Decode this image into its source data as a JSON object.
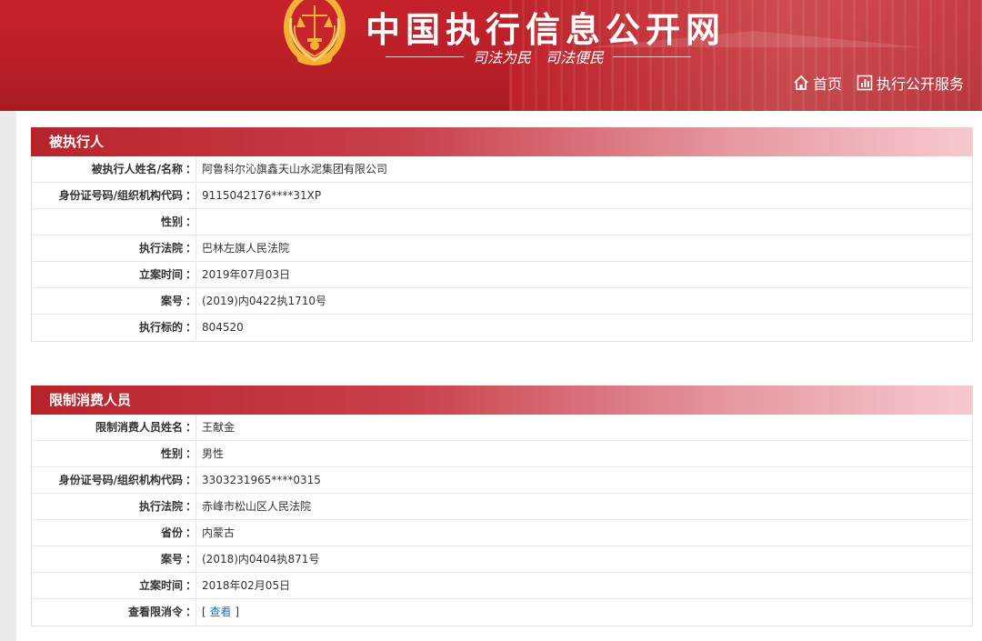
{
  "header": {
    "site_title": "中国执行信息公开网",
    "slogan": "司法为民　司法便民",
    "nav": [
      {
        "icon": "home-icon",
        "label": "首页"
      },
      {
        "icon": "chart-icon",
        "label": "执行公开服务"
      }
    ]
  },
  "colors": {
    "banner_red": "#c6232c",
    "section_red": "#b8232b",
    "link_blue": "#1e6fb8"
  },
  "executed_person": {
    "title": "被执行人",
    "rows": [
      {
        "label": "被执行人姓名/名称",
        "value": "阿鲁科尔沁旗鑫天山水泥集团有限公司"
      },
      {
        "label": "身份证号码/组织机构代码",
        "value": "9115042176****31XP"
      },
      {
        "label": "性别",
        "value": ""
      },
      {
        "label": "执行法院",
        "value": "巴林左旗人民法院"
      },
      {
        "label": "立案时间",
        "value": "2019年07月03日"
      },
      {
        "label": "案号",
        "value": "(2019)内0422执1710号"
      },
      {
        "label": "执行标的",
        "value": "804520"
      }
    ]
  },
  "restricted_person": {
    "title": "限制消费人员",
    "rows": [
      {
        "label": "限制消费人员姓名",
        "value": "王献金"
      },
      {
        "label": "性别",
        "value": "男性"
      },
      {
        "label": "身份证号码/组织机构代码",
        "value": "3303231965****0315"
      },
      {
        "label": "执行法院",
        "value": "赤峰市松山区人民法院"
      },
      {
        "label": "省份",
        "value": "内蒙古"
      },
      {
        "label": "案号",
        "value": "(2018)内0404执871号"
      },
      {
        "label": "立案时间",
        "value": "2018年02月05日"
      }
    ],
    "view_order": {
      "label": "查看限消令",
      "bracket_open": "[",
      "link": "查看",
      "bracket_close": "]"
    }
  },
  "colon": "："
}
